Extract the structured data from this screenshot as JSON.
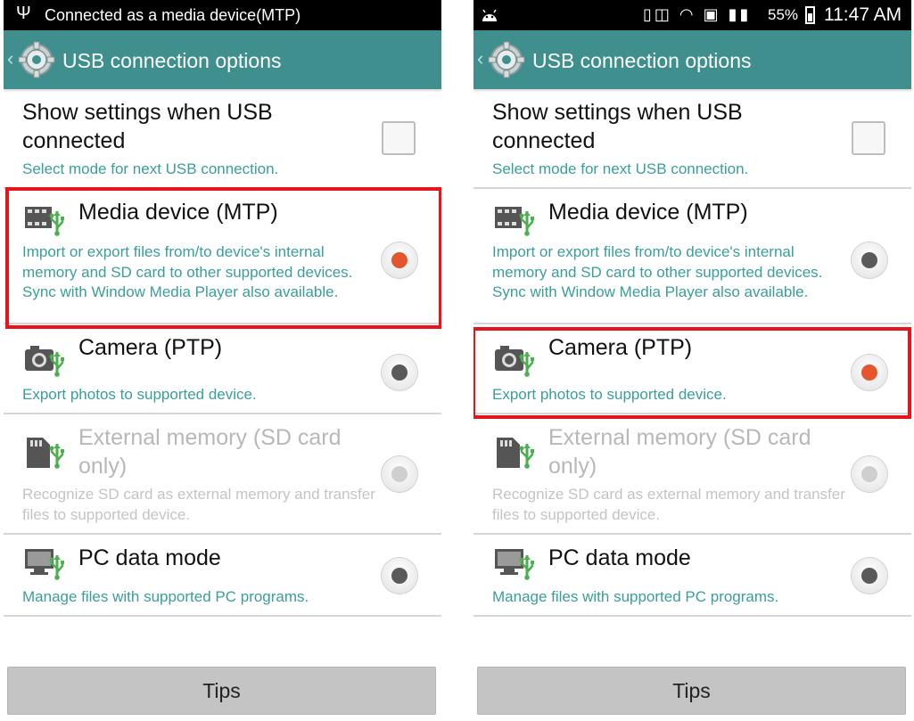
{
  "left": {
    "status_text": "Connected as a media device(MTP)",
    "selected": "mtp"
  },
  "right": {
    "battery": "55%",
    "clock": "11:47 AM",
    "selected": "ptp"
  },
  "header": {
    "title": "USB connection options"
  },
  "show_settings": {
    "title": "Show settings when USB connected",
    "desc": "Select mode for next USB connection.",
    "checked": false
  },
  "options": {
    "mtp": {
      "title": "Media device (MTP)",
      "desc": "Import or export files from/to device's internal memory and SD card to other supported devices. Sync with Window Media Player also available.",
      "icon": "media-usb-icon"
    },
    "ptp": {
      "title": "Camera (PTP)",
      "desc": "Export photos to supported device.",
      "icon": "camera-usb-icon"
    },
    "ext": {
      "title": "External memory (SD card only)",
      "desc": "Recognize SD card as external memory and transfer files to supported device.",
      "icon": "sdcard-usb-icon",
      "disabled": true
    },
    "pc": {
      "title": "PC data mode",
      "desc": "Manage files with supported PC programs.",
      "icon": "pc-usb-icon"
    }
  },
  "tips_label": "Tips",
  "colors": {
    "accent_teal": "#3f8f8f",
    "desc_teal": "#3a9e9a",
    "selected_radio": "#e4572e",
    "highlight_red": "#e8141c"
  }
}
